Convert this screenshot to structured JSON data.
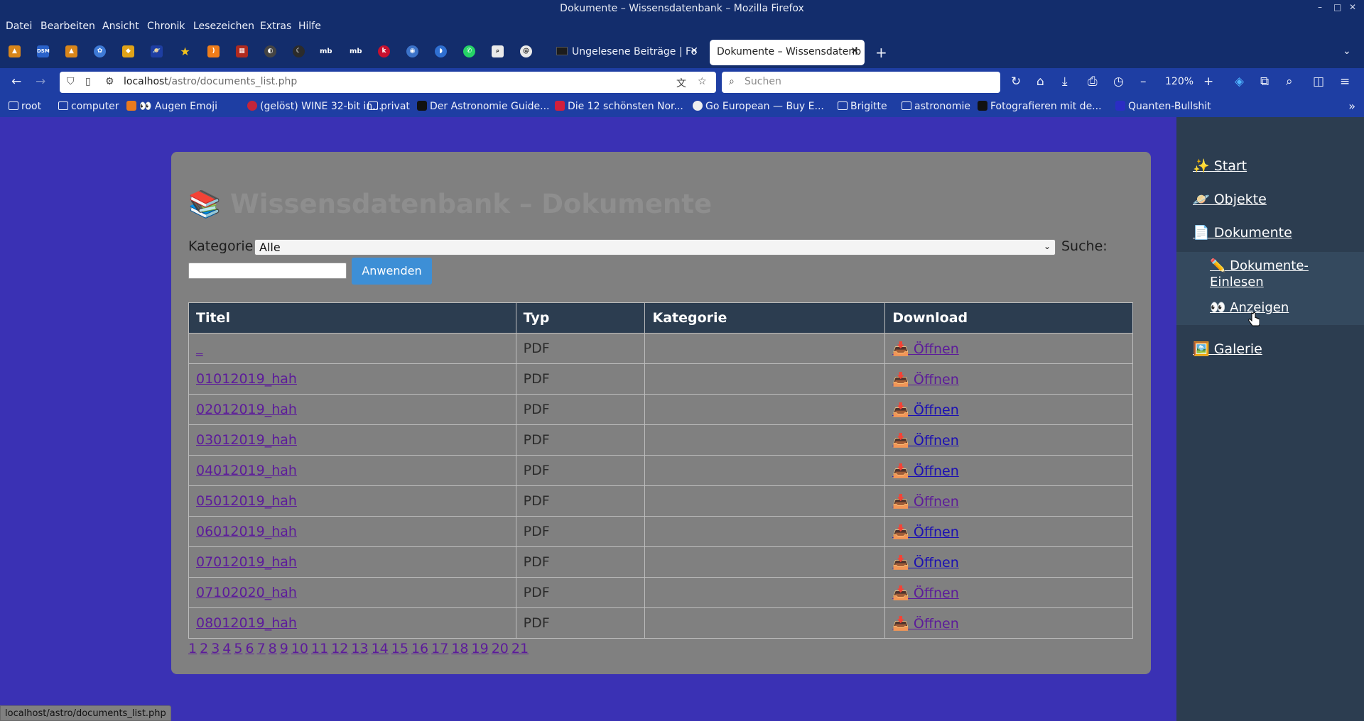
{
  "window": {
    "title": "Dokumente – Wissensdatenbank – Mozilla Firefox",
    "controls": [
      "–",
      "□",
      "✕"
    ]
  },
  "menu": [
    "Datei",
    "Bearbeiten",
    "Ansicht",
    "Chronik",
    "Lesezeichen",
    "Extras",
    "Hilfe"
  ],
  "pinned_icons": [
    "DSM",
    "mb",
    "mb"
  ],
  "tabs": [
    {
      "label": "Ungelesene Beiträge | Fo",
      "close": "✕"
    },
    {
      "label": "Dokumente – Wissensdatenb",
      "close": "✕"
    }
  ],
  "newtab": "+",
  "tablist": "⌄",
  "nav": {
    "back": "←",
    "forward": "→",
    "reload": "↻",
    "home": "⌂",
    "url_host": "localhost",
    "url_path": "/astro/documents_list.php",
    "search_placeholder": "Suchen",
    "zoom_minus": "–",
    "zoom": "120%",
    "zoom_plus": "+",
    "menu": "≡"
  },
  "bookmarks": [
    {
      "label": "root"
    },
    {
      "label": "computer"
    },
    {
      "label": "👀 Augen Emoji"
    },
    {
      "label": "(gelöst) WINE 32-bit in..."
    },
    {
      "label": "privat"
    },
    {
      "label": "Der Astronomie Guide..."
    },
    {
      "label": "Die 12 schönsten Nor..."
    },
    {
      "label": "Go European — Buy E..."
    },
    {
      "label": "Brigitte"
    },
    {
      "label": "astronomie"
    },
    {
      "label": "Fotografieren mit de..."
    },
    {
      "label": "Quanten-Bullshit"
    }
  ],
  "bookmarks_more": "»",
  "sidebar": {
    "items": [
      {
        "label": "✨ Start"
      },
      {
        "label": "🪐 Objekte"
      },
      {
        "label": "📄 Dokumente"
      },
      {
        "label": "🖼️ Galerie"
      }
    ],
    "subitems": [
      {
        "label": "✏️ Dokumente-Einlesen"
      },
      {
        "label": "👀 Anzeigen"
      }
    ]
  },
  "main": {
    "heading_emoji": "📚",
    "heading": "Wissensdatenbank – Dokumente",
    "filter_label": "Kategorie:",
    "category_selected": "Alle",
    "select_chevron": "⌄",
    "search_label": "Suche:",
    "search_value": "",
    "apply_label": "Anwenden",
    "columns": [
      "Titel",
      "Typ",
      "Kategorie",
      "Download"
    ],
    "rows": [
      {
        "title": "_",
        "type": "PDF",
        "category": "",
        "download": "📥 Öffnen",
        "visited": true
      },
      {
        "title": "01012019_hah",
        "type": "PDF",
        "category": "",
        "download": "📥 Öffnen",
        "visited": true
      },
      {
        "title": "02012019_hah",
        "type": "PDF",
        "category": "",
        "download": "📥 Öffnen",
        "visited": false
      },
      {
        "title": "03012019_hah",
        "type": "PDF",
        "category": "",
        "download": "📥 Öffnen",
        "visited": false
      },
      {
        "title": "04012019_hah",
        "type": "PDF",
        "category": "",
        "download": "📥 Öffnen",
        "visited": false
      },
      {
        "title": "05012019_hah",
        "type": "PDF",
        "category": "",
        "download": "📥 Öffnen",
        "visited": true
      },
      {
        "title": "06012019_hah",
        "type": "PDF",
        "category": "",
        "download": "📥 Öffnen",
        "visited": false
      },
      {
        "title": "07012019_hah",
        "type": "PDF",
        "category": "",
        "download": "📥 Öffnen",
        "visited": false
      },
      {
        "title": "07102020_hah",
        "type": "PDF",
        "category": "",
        "download": "📥 Öffnen",
        "visited": true
      },
      {
        "title": "08012019_hah",
        "type": "PDF",
        "category": "",
        "download": "📥 Öffnen",
        "visited": true
      }
    ],
    "pages": [
      "1",
      "2",
      "3",
      "4",
      "5",
      "6",
      "7",
      "8",
      "9",
      "10",
      "11",
      "12",
      "13",
      "14",
      "15",
      "16",
      "17",
      "18",
      "19",
      "20",
      "21"
    ]
  },
  "status_url": "localhost/astro/documents_list.php",
  "colors": {
    "page_bg": "#3a31b4",
    "sidebar_bg": "#2c3d50",
    "card_bg": "#808080",
    "table_header_bg": "#2c3d50",
    "button_bg": "#3d8fd6",
    "visited_link": "#5c1b9a",
    "link": "#1b0fb3"
  }
}
